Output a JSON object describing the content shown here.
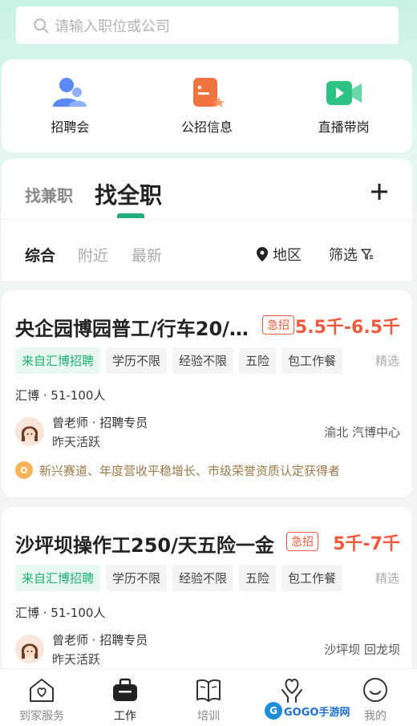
{
  "search": {
    "placeholder": "请输入职位或公司"
  },
  "quick_links": [
    {
      "label": "招聘会",
      "icon": "people-icon",
      "color": "#4d7cf5"
    },
    {
      "label": "公招信息",
      "icon": "document-star-icon",
      "color": "#f3743f"
    },
    {
      "label": "直播带岗",
      "icon": "video-camera-icon",
      "color": "#2ec385"
    }
  ],
  "tabs": {
    "part_time": "找兼职",
    "full_time": "找全职"
  },
  "filters": {
    "overall": "综合",
    "nearby": "附近",
    "latest": "最新",
    "region": "地区",
    "screen": "筛选"
  },
  "jobs": [
    {
      "title": "央企园博园普工/行车20/…",
      "badge": "急招",
      "salary": "5.5千-6.5千",
      "tags": [
        "来自汇博招聘",
        "学历不限",
        "经验不限",
        "五险",
        "包工作餐"
      ],
      "pick": "精选",
      "company": "汇博 · 51-100人",
      "recruiter_name": "曾老师 · 招聘专员",
      "recruiter_status": "昨天活跃",
      "location": "渝北 汽博中心",
      "highlight": "新兴赛道、年度营收平稳增长、市级荣誉资质认定获得者"
    },
    {
      "title": "沙坪坝操作工250/天五险一金",
      "badge": "急招",
      "salary": "5千-7千",
      "tags": [
        "来自汇博招聘",
        "学历不限",
        "经验不限",
        "五险",
        "包工作餐"
      ],
      "pick": "精选",
      "company": "汇博 · 51-100人",
      "recruiter_name": "曾老师 · 招聘专员",
      "recruiter_status": "昨天活跃",
      "location": "沙坪坝 回龙坝"
    }
  ],
  "nav": [
    {
      "label": "到家服务",
      "icon": "home-heart-icon"
    },
    {
      "label": "工作",
      "icon": "briefcase-icon",
      "active": true
    },
    {
      "label": "培训",
      "icon": "book-icon"
    },
    {
      "label": "",
      "icon": "heart-hand-icon"
    },
    {
      "label": "我的",
      "icon": "smile-icon"
    }
  ],
  "watermark": {
    "text": "GOGO手游网",
    "sub": "G"
  },
  "colors": {
    "accent": "#1fb079",
    "salary": "#f05a3c",
    "urgent": "#ef5b3e"
  }
}
